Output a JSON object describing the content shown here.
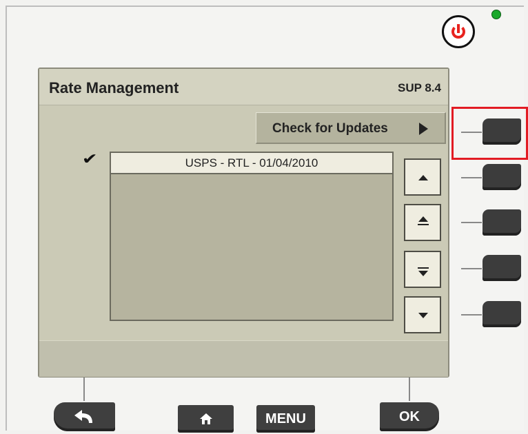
{
  "screen": {
    "title": "Rate Management",
    "version": "SUP 8.4",
    "update_button_label": "Check for Updates",
    "rate_item": "USPS - RTL - 01/04/2010",
    "check_mark": "✔"
  },
  "bottom_keys": {
    "menu_label": "MENU",
    "ok_label": "OK"
  },
  "colors": {
    "screen_bg": "#cbcab6",
    "header_bg": "#d4d3c1",
    "softkey": "#3c3c3c",
    "power_red": "#e8231f",
    "led_green": "#1aa82b",
    "highlight_red": "#e21b23"
  },
  "icons": {
    "power": "power-icon",
    "status_led": "status-led-icon",
    "play": "play-icon",
    "back": "back-arrow-icon",
    "home": "home-icon",
    "scroll_up": "arrow-up-icon",
    "page_up": "double-arrow-up-icon",
    "page_down": "double-arrow-down-icon",
    "scroll_down": "arrow-down-icon"
  }
}
